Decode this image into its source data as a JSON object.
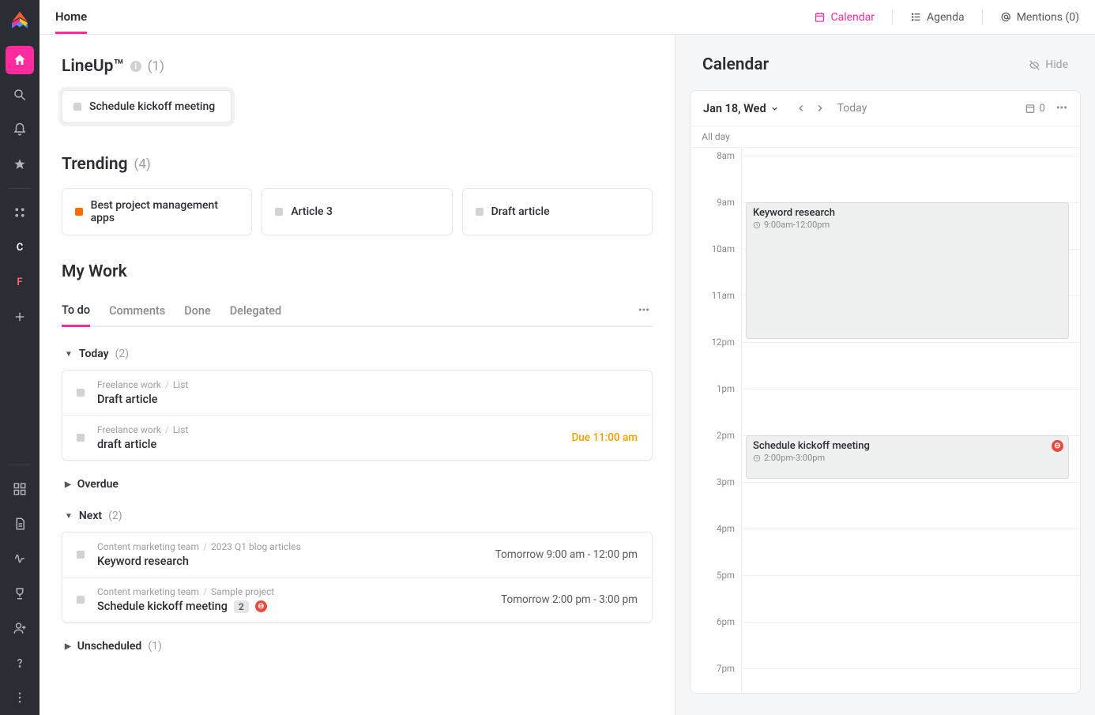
{
  "topnav": {
    "home": "Home",
    "calendar": "Calendar",
    "agenda": "Agenda",
    "mentions": "Mentions (0)"
  },
  "lineup": {
    "title": "LineUp™",
    "count": "(1)",
    "card_label": "Schedule kickoff meeting"
  },
  "trending": {
    "title": "Trending",
    "count": "(4)",
    "items": [
      "Best project management apps",
      "Article 3",
      "Draft article"
    ]
  },
  "mywork": {
    "title": "My Work",
    "tabs": [
      "To do",
      "Comments",
      "Done",
      "Delegated"
    ],
    "groups": {
      "today": {
        "label": "Today",
        "count": "(2)"
      },
      "overdue": {
        "label": "Overdue"
      },
      "next": {
        "label": "Next",
        "count": "(2)"
      },
      "unscheduled": {
        "label": "Unscheduled",
        "count": "(1)"
      }
    },
    "today_tasks": [
      {
        "crumb1": "Freelance work",
        "crumb2": "List",
        "title": "Draft article"
      },
      {
        "crumb1": "Freelance work",
        "crumb2": "List",
        "title": "draft article",
        "due": "Due 11:00 am"
      }
    ],
    "next_tasks": [
      {
        "crumb1": "Content marketing team",
        "crumb2": "2023 Q1 blog articles",
        "title": "Keyword research",
        "time": "Tomorrow 9:00 am - 12:00 pm"
      },
      {
        "crumb1": "Content marketing team",
        "crumb2": "Sample project",
        "title": "Schedule kickoff meeting",
        "time": "Tomorrow 2:00 pm - 3:00 pm",
        "badge": "2"
      }
    ]
  },
  "calendar": {
    "title": "Calendar",
    "hide": "Hide",
    "date": "Jan 18, Wed",
    "today": "Today",
    "count": "0",
    "allday": "All day",
    "hours": [
      "8am",
      "9am",
      "10am",
      "11am",
      "12pm",
      "1pm",
      "2pm",
      "3pm",
      "4pm",
      "5pm",
      "6pm",
      "7pm"
    ],
    "events": [
      {
        "title": "Keyword research",
        "time": "9:00am-12:00pm"
      },
      {
        "title": "Schedule kickoff meeting",
        "time": "2:00pm-3:00pm"
      }
    ]
  }
}
